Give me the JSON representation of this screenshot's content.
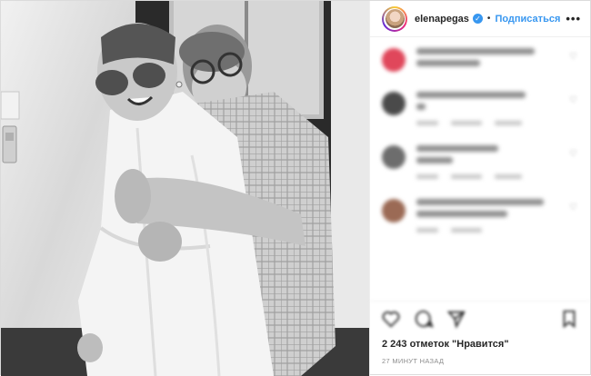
{
  "header": {
    "username": "elenapegas",
    "verified_icon": "verified-badge-icon",
    "separator": "•",
    "follow_label": "Подписаться",
    "more_icon": "more-options-icon",
    "more_glyph": "•••"
  },
  "photo": {
    "description_icon": "post-photo"
  },
  "comments": [
    {
      "avatar_color": "#e0475b"
    },
    {
      "avatar_color": "#4a4a4a"
    },
    {
      "avatar_color": "#6d6d6d"
    },
    {
      "avatar_color": "#9b6a55"
    }
  ],
  "actions": {
    "like_icon": "heart-icon",
    "comment_icon": "comment-icon",
    "share_icon": "share-icon",
    "save_icon": "bookmark-icon"
  },
  "likes_text": "2 243 отметок \"Нравится\"",
  "timestamp": "27 МИНУТ НАЗАД",
  "colors": {
    "accent": "#3897f0",
    "text": "#262626",
    "muted": "#8e8e8e",
    "border": "#efefef"
  }
}
